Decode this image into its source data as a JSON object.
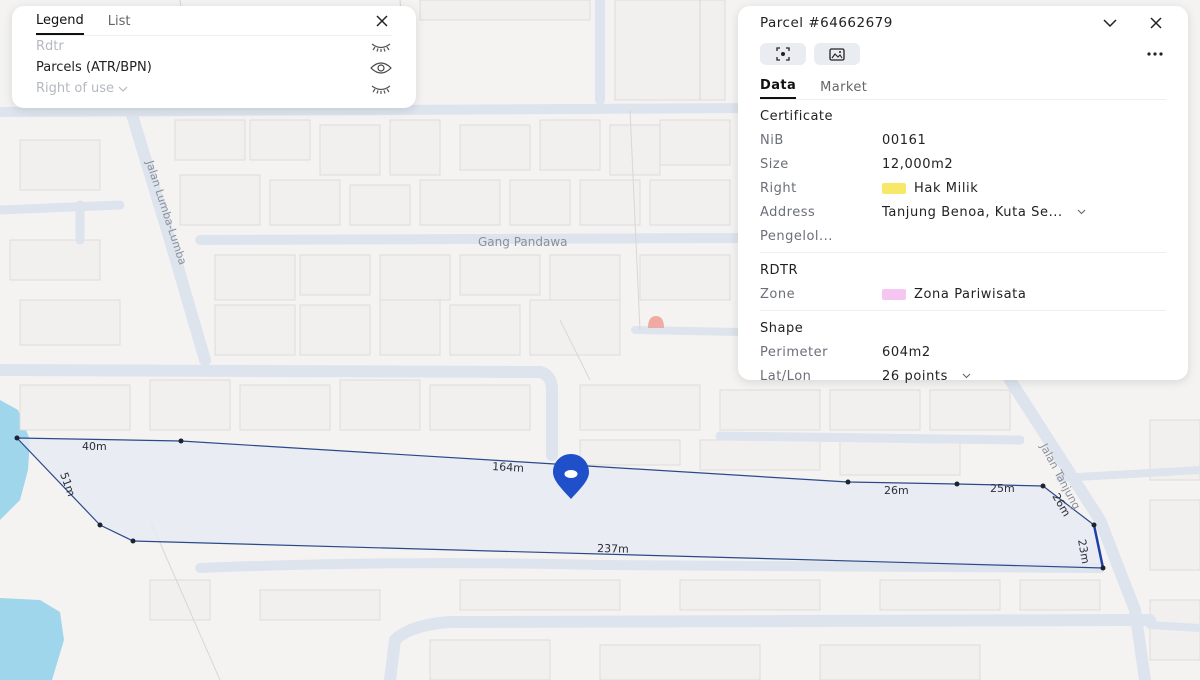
{
  "map": {
    "streets": {
      "jalan_lumba": "Jalan Lumba-Lumba",
      "gang_pandawa": "Gang Pandawa",
      "jalan_tanjung": "Jalan Tanjung"
    },
    "parcel_edges": [
      {
        "name": "edge-40m",
        "label": "40m"
      },
      {
        "name": "edge-164m",
        "label": "164m"
      },
      {
        "name": "edge-26m-top",
        "label": "26m"
      },
      {
        "name": "edge-25m",
        "label": "25m"
      },
      {
        "name": "edge-26m-side",
        "label": "26m"
      },
      {
        "name": "edge-23m",
        "label": "23m"
      },
      {
        "name": "edge-237m",
        "label": "237m"
      },
      {
        "name": "edge-51m",
        "label": "51m"
      }
    ],
    "colors": {
      "parcel_fill": "#e8eaf4",
      "parcel_stroke": "#2b4a8a",
      "water": "#9fd6ec",
      "pin": "#1f4fc9",
      "road": "#dde4ee"
    }
  },
  "legend": {
    "tabs": [
      "Legend",
      "List"
    ],
    "items": [
      {
        "label": "Rdtr",
        "visible": false,
        "icon": "eye-closed-icon"
      },
      {
        "label": "Parcels (ATR/BPN)",
        "visible": true,
        "icon": "eye-icon"
      },
      {
        "label": "Right of use",
        "visible": false,
        "icon": "eye-closed-icon"
      }
    ]
  },
  "parcel": {
    "title": "Parcel #64662679",
    "tabs": [
      "Data",
      "Market"
    ],
    "certificate": {
      "title": "Certificate",
      "nib_label": "NiB",
      "nib": "00161",
      "size_label": "Size",
      "size": "12,000m2",
      "right_label": "Right",
      "right": "Hak Milik",
      "right_color": "#f7e86a",
      "address_label": "Address",
      "address": "Tanjung Benoa, Kuta Se...",
      "pengelola_label": "Pengelol..."
    },
    "rdtr": {
      "title": "RDTR",
      "zone_label": "Zone",
      "zone": "Zona Pariwisata",
      "zone_color": "#f6c6f2"
    },
    "shape": {
      "title": "Shape",
      "perimeter_label": "Perimeter",
      "perimeter": "604m2",
      "latlon_label": "Lat/Lon",
      "latlon": "26 points"
    }
  }
}
